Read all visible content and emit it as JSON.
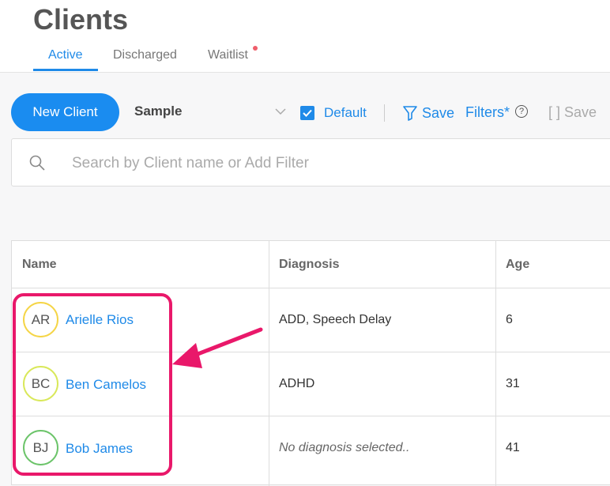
{
  "header": {
    "title": "Clients",
    "tabs": [
      {
        "label": "Active",
        "active": true
      },
      {
        "label": "Discharged",
        "active": false
      },
      {
        "label": "Waitlist",
        "active": false,
        "notification_dot": true
      }
    ]
  },
  "toolbar": {
    "new_client_label": "New Client",
    "filter_select_value": "Sample",
    "default_checkbox": {
      "label": "Default",
      "checked": true
    },
    "save_filters_save_label": "Save",
    "save_filters_filters_label": "Filters*",
    "help_label": "?",
    "save_view_label": "[ ] Save"
  },
  "search": {
    "placeholder": "Search by Client name or Add Filter"
  },
  "table": {
    "columns": [
      "Name",
      "Diagnosis",
      "Age"
    ],
    "rows": [
      {
        "initials": "AR",
        "name": "Arielle Rios",
        "diagnosis": "ADD, Speech Delay",
        "age": "6",
        "avatar_color": "#f5d547"
      },
      {
        "initials": "BC",
        "name": "Ben Camelos",
        "diagnosis": "ADHD",
        "age": "31",
        "avatar_color": "#d9e85a"
      },
      {
        "initials": "BJ",
        "name": "Bob James",
        "diagnosis": "No diagnosis selected..",
        "age": "41",
        "avatar_color": "#6cc46a"
      }
    ]
  },
  "colors": {
    "accent": "#1f8ae8",
    "highlight": "#e9186a",
    "notification": "#ef5e6b"
  }
}
